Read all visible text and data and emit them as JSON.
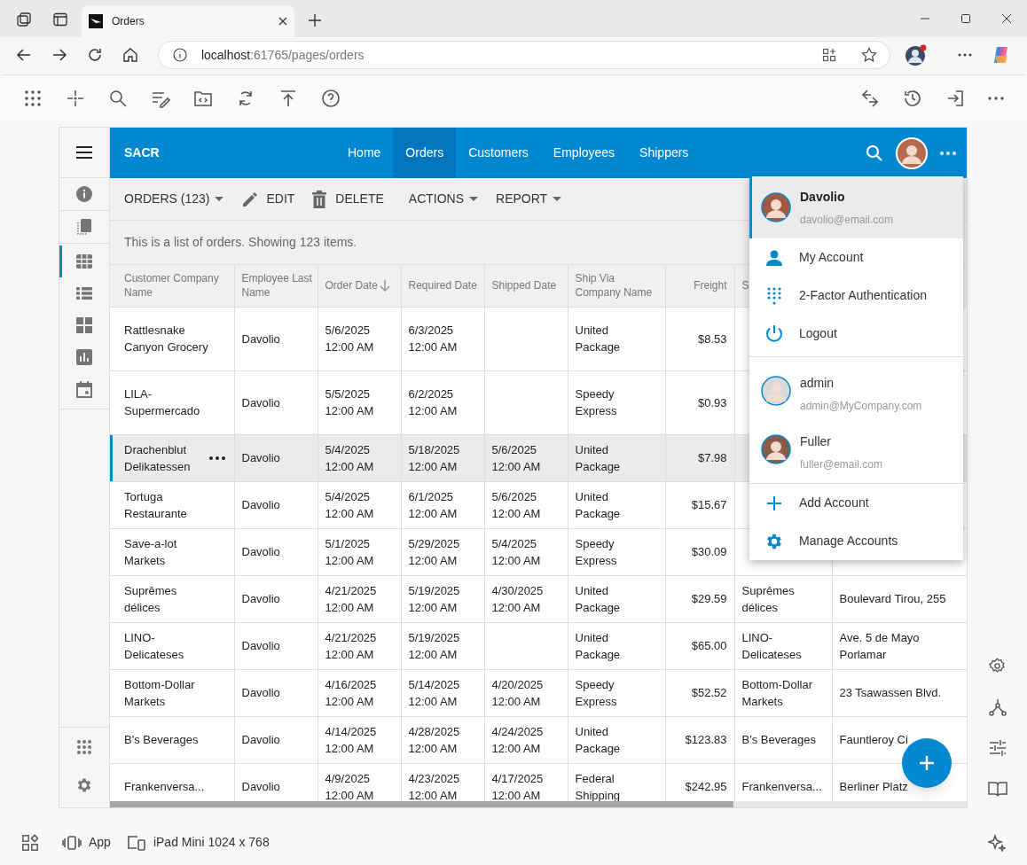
{
  "browser": {
    "tabs": [
      {
        "title": "Orders",
        "selected": true
      }
    ],
    "address": {
      "host": "localhost",
      "path": ":61765/pages/orders"
    }
  },
  "bottom_bar": {
    "items": [
      {
        "label": "App",
        "kind": "app"
      },
      {
        "label": "iPad Mini 1024 x 768",
        "kind": "device"
      }
    ]
  },
  "app": {
    "brand": "SACR",
    "nav": [
      {
        "label": "Home",
        "selected": false
      },
      {
        "label": "Orders",
        "selected": true
      },
      {
        "label": "Customers",
        "selected": false
      },
      {
        "label": "Employees",
        "selected": false
      },
      {
        "label": "Shippers",
        "selected": false
      }
    ],
    "sidebar": [
      {
        "kind": "info",
        "selected": false
      },
      {
        "kind": "pages",
        "selected": false
      },
      {
        "kind": "grid",
        "selected": true
      },
      {
        "kind": "list",
        "selected": false
      },
      {
        "kind": "tiles",
        "selected": false
      },
      {
        "kind": "chart",
        "selected": false
      },
      {
        "kind": "calendar",
        "selected": false
      }
    ],
    "toolbar": [
      {
        "label": "ORDERS (123)",
        "kind": "dropdown"
      },
      {
        "label": "EDIT",
        "kind": "edit"
      },
      {
        "label": "DELETE",
        "kind": "delete"
      },
      {
        "label": "ACTIONS",
        "kind": "dropdown"
      },
      {
        "label": "REPORT",
        "kind": "dropdown"
      }
    ],
    "description": "This is a list of orders. Showing 123 items.",
    "table": {
      "columns": [
        {
          "label": "Customer Company Name",
          "sorted": false
        },
        {
          "label": "Employee Last Name",
          "sorted": false
        },
        {
          "label": "Order Date",
          "sorted": true
        },
        {
          "label": "Required Date",
          "sorted": false
        },
        {
          "label": "Shipped Date",
          "sorted": false
        },
        {
          "label": "Ship Via Company Name",
          "sorted": false
        },
        {
          "label": "Freight",
          "sorted": false
        },
        {
          "label": "S",
          "sorted": false
        },
        {}
      ],
      "rows": [
        {
          "selected": false,
          "cells": [
            "Rattlesnake Canyon Grocery",
            "Davolio",
            "5/6/2025 12:00 AM",
            "6/3/2025 12:00 AM",
            null,
            "United Package",
            "$8.53",
            null,
            null
          ]
        },
        {
          "selected": false,
          "cells": [
            "LILA-Supermercado",
            "Davolio",
            "5/5/2025 12:00 AM",
            "6/2/2025 12:00 AM",
            null,
            "Speedy Express",
            "$0.93",
            null,
            null
          ]
        },
        {
          "selected": true,
          "cells": [
            "Drachenblut Delikatessen",
            "Davolio",
            "5/4/2025 12:00 AM",
            "5/18/2025 12:00 AM",
            "5/6/2025 12:00 AM",
            "United Package",
            "$7.98",
            null,
            null
          ]
        },
        {
          "selected": false,
          "cells": [
            "Tortuga Restaurante",
            "Davolio",
            "5/4/2025 12:00 AM",
            "6/1/2025 12:00 AM",
            "5/6/2025 12:00 AM",
            "United Package",
            "$15.67",
            null,
            null
          ]
        },
        {
          "selected": false,
          "cells": [
            "Save-a-lot Markets",
            "Davolio",
            "5/1/2025 12:00 AM",
            "5/29/2025 12:00 AM",
            "5/4/2025 12:00 AM",
            "Speedy Express",
            "$30.09",
            null,
            null
          ]
        },
        {
          "selected": false,
          "cells": [
            "Suprêmes délices",
            "Davolio",
            "4/21/2025 12:00 AM",
            "5/19/2025 12:00 AM",
            "4/30/2025 12:00 AM",
            "United Package",
            "$29.59",
            "Suprêmes délices",
            "Boulevard Tirou, 255"
          ]
        },
        {
          "selected": false,
          "cells": [
            "LINO-Delicateses",
            "Davolio",
            "4/21/2025 12:00 AM",
            "5/19/2025 12:00 AM",
            null,
            "United Package",
            "$65.00",
            "LINO-Delicateses",
            "Ave. 5 de Mayo Porlamar"
          ]
        },
        {
          "selected": false,
          "cells": [
            "Bottom-Dollar Markets",
            "Davolio",
            "4/16/2025 12:00 AM",
            "5/14/2025 12:00 AM",
            "4/20/2025 12:00 AM",
            "Speedy Express",
            "$52.52",
            "Bottom-Dollar Markets",
            "23 Tsawassen Blvd."
          ]
        },
        {
          "selected": false,
          "cells": [
            "B's Beverages",
            "Davolio",
            "4/14/2025 12:00 AM",
            "4/28/2025 12:00 AM",
            "4/24/2025 12:00 AM",
            "United Package",
            "$123.83",
            "B's Beverages",
            "Fauntleroy Ci"
          ]
        },
        {
          "selected": false,
          "cells": [
            "Frankenversa...",
            "Davolio",
            "4/9/2025 12:00 AM",
            "4/23/2025 12:00 AM",
            "4/17/2025 12:00 AM",
            "Federal Shipping",
            "$242.95",
            "Frankenversa...",
            "Berliner Platz"
          ]
        }
      ]
    },
    "account_menu": {
      "current": {
        "name": "Davolio",
        "email": "davolio@email.com"
      },
      "items": [
        {
          "label": "My Account",
          "kind": "account"
        },
        {
          "label": "2-Factor Authentication",
          "kind": "twofactor"
        },
        {
          "label": "Logout",
          "kind": "logout"
        }
      ],
      "accounts": [
        {
          "name": "admin",
          "email": "admin@MyCompany.com"
        },
        {
          "name": "Fuller",
          "email": "fuller@email.com"
        }
      ],
      "actions": [
        {
          "label": "Add Account",
          "kind": "add"
        },
        {
          "label": "Manage Accounts",
          "kind": "manage"
        }
      ]
    }
  }
}
